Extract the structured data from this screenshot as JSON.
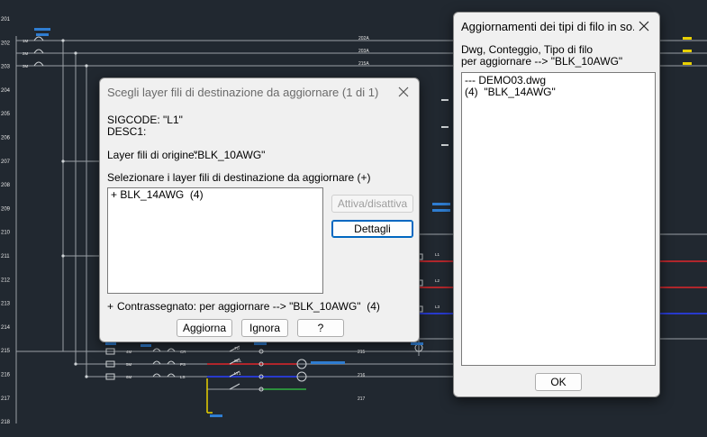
{
  "background": {
    "color": "#212830"
  },
  "cad": {
    "row_numbers": [
      "201",
      "202",
      "203",
      "204",
      "205",
      "206",
      "207",
      "208",
      "209",
      "210",
      "211",
      "212",
      "213",
      "214",
      "215",
      "216",
      "217",
      "218"
    ],
    "wire_labels": [
      "202A",
      "203A",
      "215A",
      "216A",
      "217A",
      "218A"
    ],
    "right_labels": [
      "202",
      "203",
      "204",
      "215",
      "216",
      "217",
      "218"
    ],
    "small_labels": [
      "1M",
      "2M",
      "3M",
      "4M",
      "5M",
      "6M",
      "CR",
      "PS",
      "LS",
      "TD",
      "SEL",
      "LT1",
      "L1",
      "L2",
      "L3"
    ]
  },
  "dialog_main": {
    "title": "Scegli layer fili di destinazione da aggiornare  (1 di 1)",
    "sigcode": "SIGCODE: \"L1\"",
    "desc": "DESC1:",
    "origin_label": "Layer fili di origine:",
    "origin_value": "\"BLK_10AWG\"",
    "select_label": "Selezionare i layer fili di destinazione da aggiornare (+)",
    "list_items": [
      "+ BLK_14AWG  (4)"
    ],
    "toggle_button": "Attiva/disattiva",
    "details_button": "Dettagli",
    "marked_prefix": "+",
    "marked_text": "Contrassegnato: per aggiornare --> \"BLK_10AWG\"  (4)",
    "update_button": "Aggiorna",
    "ignore_button": "Ignora",
    "help_button": "?"
  },
  "dialog_updates": {
    "title": "Aggiornamenti dei tipi di filo in so...",
    "header_line1": "Dwg, Conteggio, Tipo di filo",
    "header_line2": "per aggiornare --> \"BLK_10AWG\"",
    "list_items": [
      "--- DEMO03.dwg",
      "(4)  \"BLK_14AWG\""
    ],
    "ok_button": "OK"
  },
  "colors": {
    "wire_gray": "#9aa0a6",
    "wire_red": "#e0262a",
    "wire_blue": "#2a40ff",
    "wire_yellow": "#e8d000",
    "wire_green": "#30b040",
    "annotation_blue": "#2f7dd1",
    "text_white": "#e6e6e6",
    "default_button_border": "#0067c0"
  }
}
